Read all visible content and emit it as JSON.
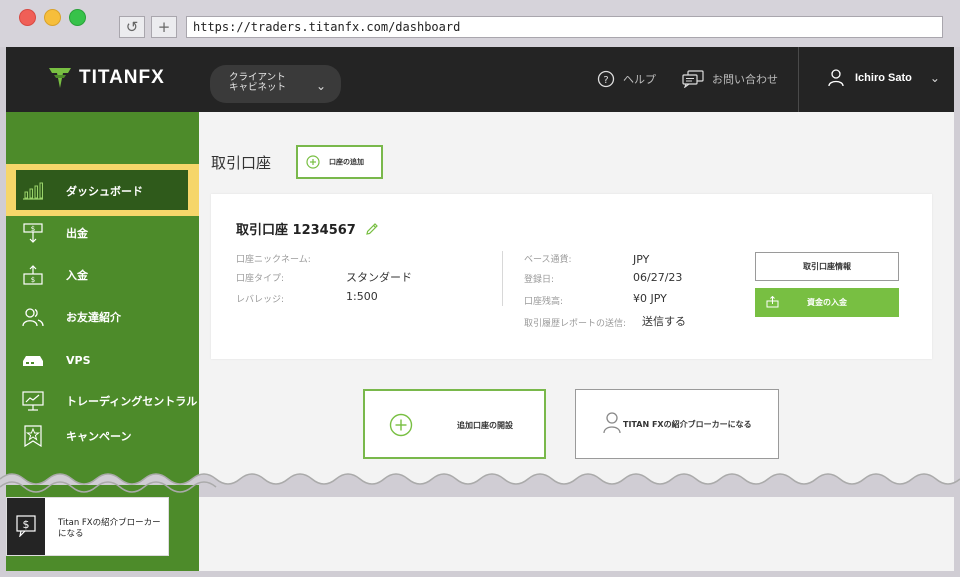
{
  "browser": {
    "url": "https://traders.titanfx.com/dashboard",
    "reload_glyph": "↺",
    "newtab_glyph": "+"
  },
  "header": {
    "logo_text": "TITANFX",
    "portal_line1": "クライアント",
    "portal_line2": "キャビネット",
    "help_label": "ヘルプ",
    "contact_label": "お問い合わせ",
    "user_name": "Ichiro Sato"
  },
  "sidebar": {
    "items": [
      {
        "label": "ダッシュボード",
        "icon": "bar-chart-icon"
      },
      {
        "label": "出金",
        "icon": "withdraw-icon"
      },
      {
        "label": "入金",
        "icon": "deposit-icon"
      },
      {
        "label": "お友達紹介",
        "icon": "referral-icon"
      },
      {
        "label": "VPS",
        "icon": "server-icon"
      },
      {
        "label": "トレーディングセントラル",
        "icon": "trading-central-icon"
      },
      {
        "label": "キャンペーン",
        "icon": "campaign-icon"
      }
    ],
    "ib_promo": "Titan FXの紹介ブローカーになる"
  },
  "main": {
    "page_title": "取引口座",
    "add_account_label": "口座の追加",
    "account": {
      "title": "取引口座 1234567",
      "nickname_label": "口座ニックネーム:",
      "type_label": "口座タイプ:",
      "type_value": "スタンダード",
      "leverage_label": "レバレッジ:",
      "leverage_value": "1:500",
      "currency_label": "ベース通貨:",
      "currency_value": "JPY",
      "registered_label": "登録日:",
      "registered_value": "06/27/23",
      "balance_label": "口座残高:",
      "balance_value": "¥0 JPY",
      "report_label": "取引履歴レポートの送信:",
      "report_value": "送信する",
      "info_button": "取引口座情報",
      "deposit_button": "資金の入金"
    },
    "open_additional_label": "追加口座の開設",
    "become_broker_label": "TITAN FXの紹介ブローカーになる"
  },
  "colors": {
    "brand_green": "#78bf42",
    "sidebar_green": "#4d8b2a",
    "active_dark_green": "#2f5a1b",
    "highlight_yellow": "#f6d66a",
    "topbar": "#242424"
  }
}
